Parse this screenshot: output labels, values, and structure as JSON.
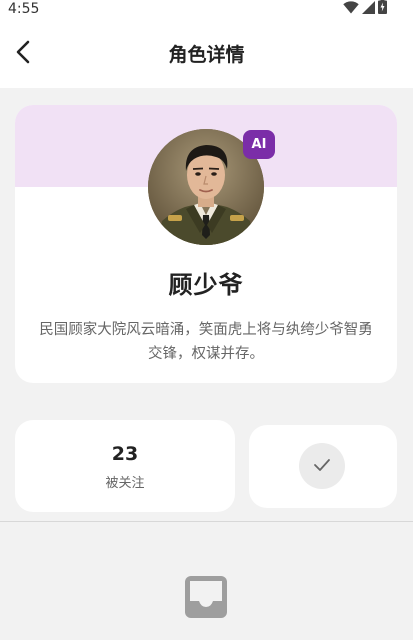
{
  "status_bar": {
    "time": "4:55",
    "icons": [
      "wifi-icon",
      "signal-icon",
      "battery-icon"
    ]
  },
  "header": {
    "title": "角色详情",
    "back_icon": "chevron-left-icon"
  },
  "profile": {
    "badge": "AI",
    "name": "顾少爷",
    "description": "民国顾家大院风云暗涌，笑面虎上将与纨绔少爷智勇交锋，权谋并存。",
    "banner_color": "#f1e1f5",
    "badge_color": "#7b2da8"
  },
  "stats": {
    "followers_count": "23",
    "followers_label": "被关注"
  },
  "follow": {
    "icon": "check-icon"
  },
  "empty_state": {
    "icon": "inbox-icon"
  }
}
